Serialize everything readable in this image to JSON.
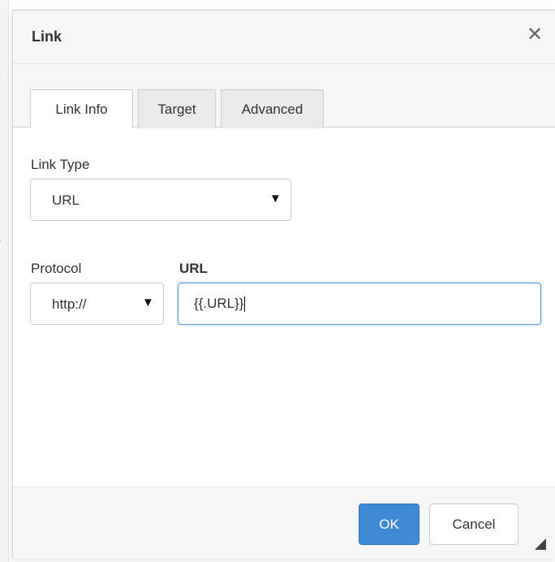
{
  "dialog": {
    "title": "Link",
    "close_icon": "close-icon",
    "close_glyph": "✕"
  },
  "tabs": [
    {
      "label": "Link Info",
      "active": true
    },
    {
      "label": "Target",
      "active": false
    },
    {
      "label": "Advanced",
      "active": false
    }
  ],
  "link_type": {
    "label": "Link Type",
    "selected": "URL",
    "arrow_icon": "dropdown-arrow-icon",
    "arrow_glyph": "▼"
  },
  "protocol": {
    "label": "Protocol",
    "selected": "http://",
    "arrow_icon": "dropdown-arrow-icon",
    "arrow_glyph": "▼"
  },
  "url": {
    "label": "URL",
    "value": "{{.URL}}"
  },
  "footer": {
    "ok_label": "OK",
    "cancel_label": "Cancel",
    "resize_icon": "resize-handle-icon"
  },
  "colors": {
    "primary_button": "#3f89d5",
    "focus_border": "#5b9dd9",
    "header_bg": "#f6f6f6"
  }
}
